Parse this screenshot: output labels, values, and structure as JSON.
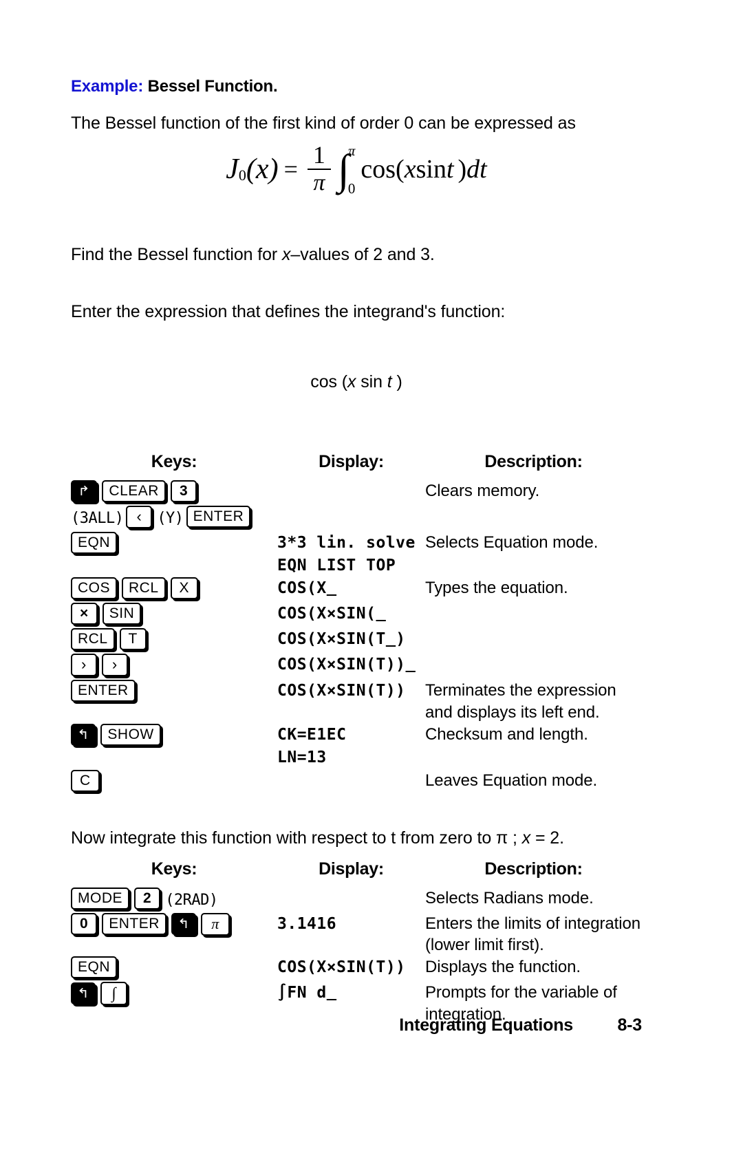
{
  "example": {
    "label": "Example:",
    "title": "Bessel Function."
  },
  "intro": {
    "line1_a": "The Bessel function of the first kind of order 0 can be expressed as",
    "find_a": "Find the Bessel function for ",
    "find_it": "x",
    "find_b": "–values of 2 and 3.",
    "enter_line": "Enter the expression that defines the integrand's function:",
    "integrand_a": "cos (",
    "integrand_x": "x",
    "integrand_mid": " sin ",
    "integrand_t": "t",
    "integrand_b": " )",
    "now_a": "Now integrate this function with respect to t from zero to π ; ",
    "now_x": "x",
    "now_b": " = 2."
  },
  "equation": {
    "j": "J",
    "sub": "0",
    "open": "(",
    "var": "x",
    "close": ")",
    "equals": "=",
    "num": "1",
    "den": "π",
    "integral": "∫",
    "upper": "π",
    "lower": "0",
    "cos": "cos(",
    "x": "x",
    "sin": " sin ",
    "t": "t",
    "closep": ")",
    "dt": "dt"
  },
  "table1": {
    "headers": {
      "keys": "Keys:",
      "display": "Display:",
      "description": "Description:"
    },
    "rows": [
      {
        "keys": [
          {
            "label": "↱",
            "style": "filled-arrow"
          },
          {
            "label": "CLEAR",
            "style": "plain"
          },
          {
            "label": "3",
            "style": "bold-narrow"
          }
        ],
        "display": [],
        "description": "Clears memory."
      },
      {
        "keys": [
          {
            "label": "(3ALL)",
            "style": "lcd-note"
          },
          {
            "label": "‹",
            "style": "chev"
          },
          {
            "label": "(Y)",
            "style": "lcd-note"
          },
          {
            "label": "ENTER",
            "style": "plain"
          }
        ],
        "display": [],
        "description": ""
      },
      {
        "keys": [
          {
            "label": "EQN",
            "style": "plain"
          }
        ],
        "display": [
          "3*3 lin. solve",
          "EQN LIST TOP"
        ],
        "description": "Selects Equation mode."
      },
      {
        "keys": [
          {
            "label": "COS",
            "style": "plain"
          },
          {
            "label": "RCL",
            "style": "plain"
          },
          {
            "label": "X",
            "style": "narrow"
          }
        ],
        "display": [
          "COS(X_"
        ],
        "description": "Types the equation."
      },
      {
        "keys": [
          {
            "label": "×",
            "style": "bold-narrow"
          },
          {
            "label": "SIN",
            "style": "plain"
          }
        ],
        "display": [
          "COS(X×SIN(_"
        ],
        "description": ""
      },
      {
        "keys": [
          {
            "label": "RCL",
            "style": "plain"
          },
          {
            "label": "T",
            "style": "narrow"
          }
        ],
        "display": [
          "COS(X×SIN(T_)"
        ],
        "description": ""
      },
      {
        "keys": [
          {
            "label": "›",
            "style": "chev"
          },
          {
            "label": "›",
            "style": "chev"
          }
        ],
        "display": [
          "COS(X×SIN(T))_"
        ],
        "description": ""
      },
      {
        "keys": [
          {
            "label": "ENTER",
            "style": "plain"
          }
        ],
        "display": [
          "COS(X×SIN(T))"
        ],
        "description": "Terminates the expression and displays its left end."
      },
      {
        "keys": [
          {
            "label": "↰",
            "style": "filled-left"
          },
          {
            "label": "SHOW",
            "style": "plain"
          }
        ],
        "display": [
          "CK=E1EC",
          "LN=13"
        ],
        "description": "Checksum and length."
      },
      {
        "keys": [
          {
            "label": "C",
            "style": "narrow"
          }
        ],
        "display": [],
        "description": "Leaves Equation mode."
      }
    ]
  },
  "table2": {
    "headers": {
      "keys": "Keys:",
      "display": "Display:",
      "description": "Description:"
    },
    "rows": [
      {
        "keys": [
          {
            "label": "MODE",
            "style": "plain"
          },
          {
            "label": "2",
            "style": "bold-narrow"
          },
          {
            "label": "(2RAD)",
            "style": "lcd-note"
          }
        ],
        "display": [],
        "description": "Selects Radians mode."
      },
      {
        "keys": [
          {
            "label": "0",
            "style": "bold-narrow"
          },
          {
            "label": "ENTER",
            "style": "plain"
          },
          {
            "label": "↰",
            "style": "filled-left"
          },
          {
            "label": "π",
            "style": "sym"
          }
        ],
        "display": [
          "3.1416"
        ],
        "description": "Enters the limits of integration (lower limit first)."
      },
      {
        "keys": [
          {
            "label": "EQN",
            "style": "plain"
          }
        ],
        "display": [
          "COS(X×SIN(T))"
        ],
        "description": "Displays the function."
      },
      {
        "keys": [
          {
            "label": "↰",
            "style": "filled-left"
          },
          {
            "label": "∫",
            "style": "slash"
          }
        ],
        "display": [
          "∫FN d_"
        ],
        "description": "Prompts for the variable of integration."
      }
    ]
  },
  "footer": {
    "title": "Integrating Equations",
    "page": "8-3"
  }
}
